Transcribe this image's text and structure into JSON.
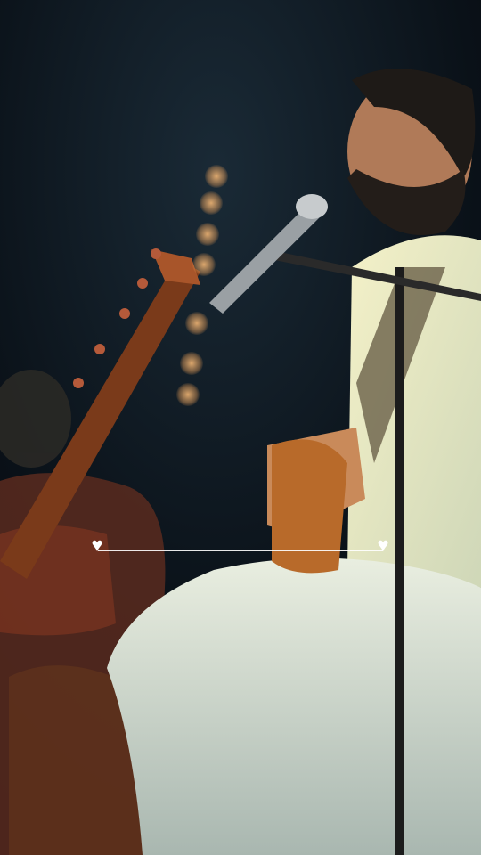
{
  "player": {
    "progress": 0.0,
    "start_icon": "heart-icon",
    "end_icon": "heart-icon",
    "icon_glyph": "♥"
  },
  "colors": {
    "background": "#0b0f14",
    "accent": "#ffffff",
    "shirt": "#efe6a0"
  }
}
